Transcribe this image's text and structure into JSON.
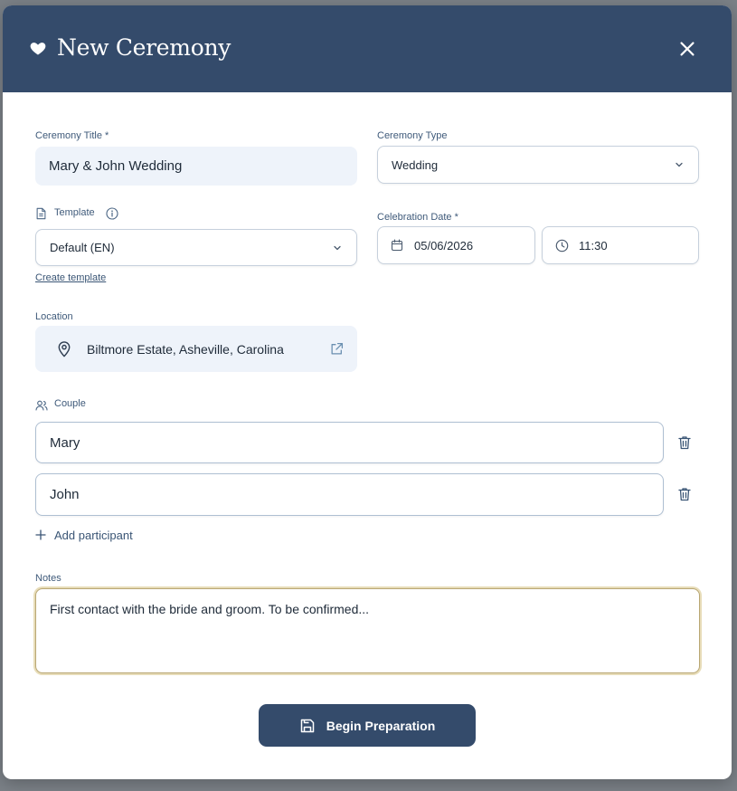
{
  "modal": {
    "title": "New Ceremony"
  },
  "form": {
    "ceremony_title": {
      "label": "Ceremony Title *",
      "value": "Mary & John Wedding"
    },
    "ceremony_type": {
      "label": "Ceremony Type",
      "value": "Wedding"
    },
    "template": {
      "label": "Template",
      "value": "Default (EN)",
      "create_link": "Create template"
    },
    "celebration_date": {
      "label": "Celebration Date *",
      "date": "05/06/2026",
      "time": "11:30"
    },
    "location": {
      "label": "Location",
      "value": "Biltmore Estate, Asheville, Carolina"
    },
    "couple": {
      "label": "Couple",
      "participants": [
        "Mary",
        "John"
      ],
      "add_label": "Add participant"
    },
    "notes": {
      "label": "Notes",
      "value": "First contact with the bride and groom. To be confirmed..."
    }
  },
  "actions": {
    "submit_label": "Begin Preparation"
  },
  "icons": {
    "header": "heart-icon",
    "close": "close-icon",
    "template": "document-icon",
    "info": "info-icon",
    "date": "calendar-icon",
    "time": "clock-icon",
    "location": "map-pin-icon",
    "external": "external-link-icon",
    "couple": "users-icon",
    "delete": "trash-icon",
    "add": "plus-icon",
    "submit": "save-icon"
  },
  "colors": {
    "header_bg": "#344b6b",
    "accent": "#344b6b",
    "notes_focus": "#b9a774"
  }
}
